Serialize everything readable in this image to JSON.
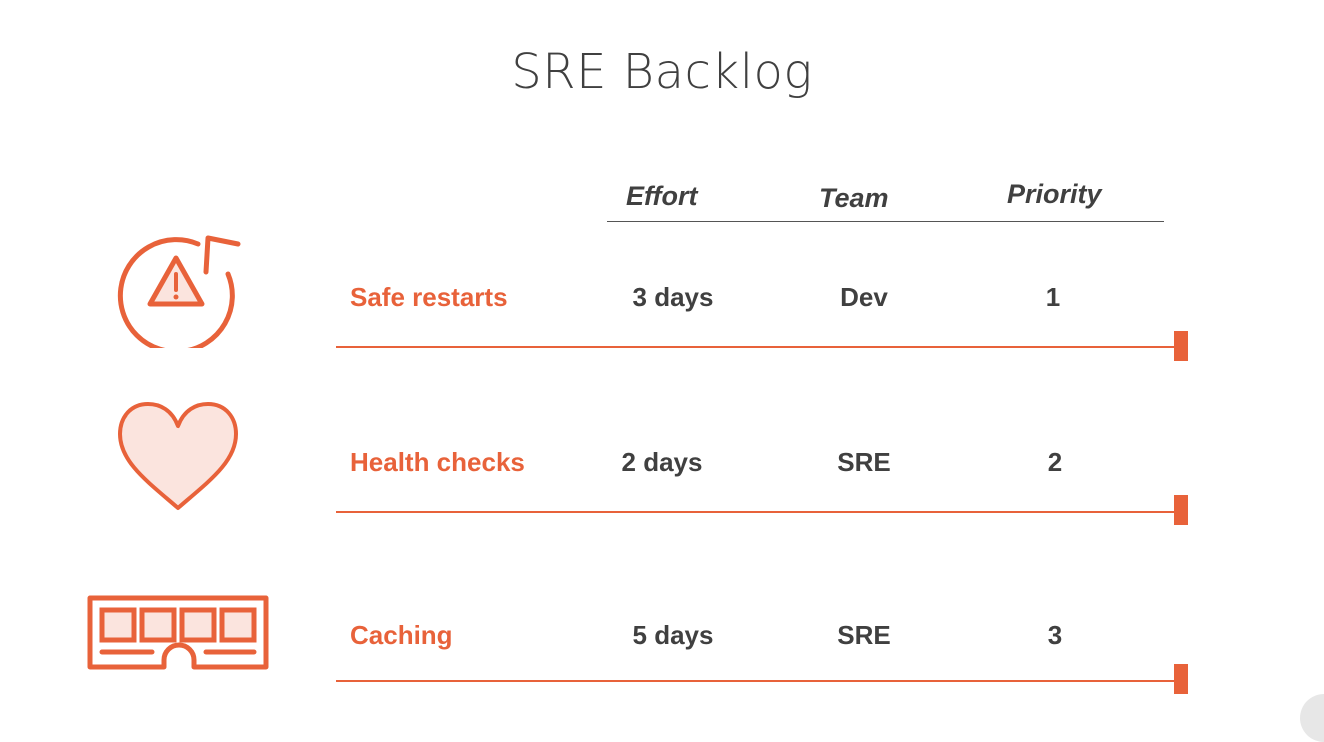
{
  "title": "SRE Backlog",
  "columns": {
    "effort": "Effort",
    "team": "Team",
    "priority": "Priority"
  },
  "rows": [
    {
      "label": "Safe restarts",
      "effort": "3 days",
      "team": "Dev",
      "priority": "1",
      "icon": "warning-restart-icon"
    },
    {
      "label": "Health checks",
      "effort": "2 days",
      "team": "SRE",
      "priority": "2",
      "icon": "heart-icon"
    },
    {
      "label": "Caching",
      "effort": "5 days",
      "team": "SRE",
      "priority": "3",
      "icon": "memory-module-icon"
    }
  ],
  "colors": {
    "accent": "#e8623a",
    "text": "#404040",
    "heart_fill": "#fbe4de"
  }
}
